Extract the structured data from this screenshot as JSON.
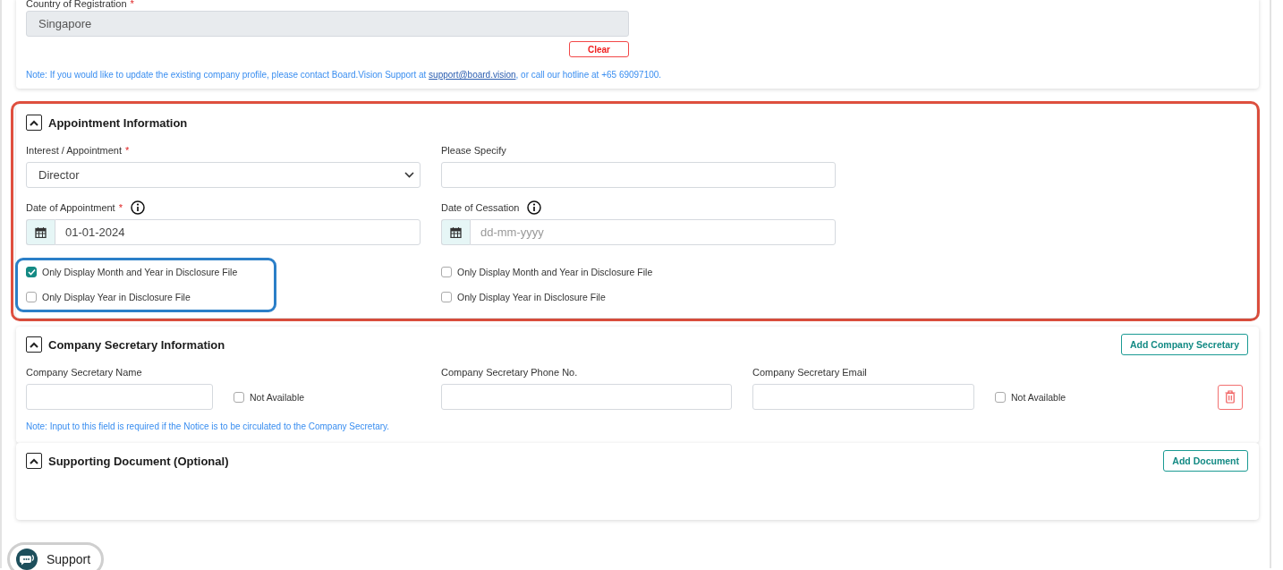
{
  "company_profile": {
    "country_label": "Country of Registration",
    "required_mark": "*",
    "country_value": "Singapore",
    "disabled": true,
    "clear_button": "Clear",
    "note_before": "Note: If you would like to update the existing company profile, please contact Board.Vision Support at ",
    "support_email": "support@board.vision",
    "note_after": ", or call our hotline at +65 69097100."
  },
  "appointment": {
    "title": "Appointment Information",
    "expanded": true,
    "highlighted": true,
    "interest": {
      "label": "Interest / Appointment",
      "required_mark": "*",
      "value": "Director"
    },
    "specify": {
      "label": "Please Specify"
    },
    "columns": [
      {
        "date_label": "Date of Appointment",
        "required_mark": "*",
        "date_value": "01-01-2024",
        "highlighted": true,
        "options": [
          {
            "label": "Only Display Month and Year in Disclosure File",
            "checked": true
          },
          {
            "label": "Only Display Year in Disclosure File",
            "checked": false
          }
        ]
      },
      {
        "date_label": "Date of Cessation",
        "placeholder": "dd-mm-yyyy",
        "highlighted": false,
        "options": [
          {
            "label": "Only Display Month and Year in Disclosure File",
            "checked": false
          },
          {
            "label": "Only Display Year in Disclosure File",
            "checked": false
          }
        ]
      }
    ]
  },
  "company_secretary": {
    "title": "Company Secretary Information",
    "expanded": true,
    "add_button": "Add Company Secretary",
    "name_label": "Company Secretary Name",
    "name_not_available": {
      "label": "Not Available",
      "checked": false
    },
    "phone_label": "Company Secretary Phone No.",
    "email_label": "Company Secretary Email",
    "email_not_available": {
      "label": "Not Available",
      "checked": false
    },
    "note": "Note: Input to this field is required if the Notice is to be circulated to the Company Secretary."
  },
  "supporting_document": {
    "title": "Supporting Document (Optional)",
    "expanded": true,
    "add_button": "Add Document"
  },
  "support_widget": {
    "label": "Support"
  }
}
